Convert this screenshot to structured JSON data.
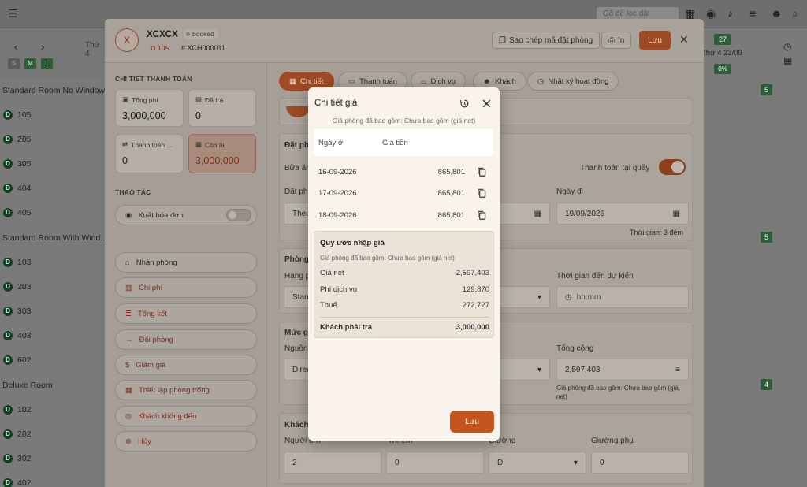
{
  "app": {
    "search_placeholder": "Gõ để lọc dặt",
    "date_prev": "Thứ 4",
    "date_right": "Thứ 4 23/09",
    "badge_27": "27",
    "badge_pct": "0%",
    "size_s": "S",
    "size_m": "M",
    "size_l": "L"
  },
  "room_groups": [
    {
      "name": "Standard Room No Window",
      "rooms": [
        "105",
        "205",
        "305",
        "404",
        "405"
      ]
    },
    {
      "name": "Standard Room With Wind...",
      "rooms": [
        "103",
        "203",
        "303",
        "403",
        "602"
      ]
    },
    {
      "name": "Deluxe Room",
      "rooms": [
        "102",
        "202",
        "302",
        "402"
      ]
    }
  ],
  "room_status_letter": "D",
  "right_badges": [
    "5",
    "5",
    "4"
  ],
  "booking": {
    "avatar": "X",
    "guest_name": "XCXCX",
    "status": "booked",
    "room_no": "105",
    "code": "# XCH000011",
    "copy_code_label": "Sao chép mã đặt phòng",
    "print_label": "In",
    "save_label": "Lưu"
  },
  "payment": {
    "section_title": "CHI TIẾT THANH TOÁN",
    "total_label": "Tổng phí",
    "total_value": "3,000,000",
    "paid_label": "Đã trả",
    "paid_value": "0",
    "payment_label": "Thanh toán ...",
    "payment_value": "0",
    "remaining_label": "Còn lại",
    "remaining_value": "3,000,000"
  },
  "actions": {
    "section_title": "THAO TÁC",
    "items": [
      {
        "label": "Xuất hóa đơn",
        "icon": "user-circle-icon"
      },
      {
        "label": "Nhận phòng",
        "icon": "bed-icon"
      },
      {
        "label": "Chi phí",
        "icon": "receipt-icon"
      },
      {
        "label": "Tổng kết",
        "icon": "list-icon"
      },
      {
        "label": "Đổi phòng",
        "icon": "arrow-right-icon"
      },
      {
        "label": "Giảm giá",
        "icon": "dollar-icon"
      },
      {
        "label": "Thiết lập phòng trống",
        "icon": "calendar-icon"
      },
      {
        "label": "Khách không đến",
        "icon": "no-show-icon"
      },
      {
        "label": "Hủy",
        "icon": "cancel-icon"
      }
    ]
  },
  "tabs": [
    {
      "label": "Chi tiết"
    },
    {
      "label": "Thanh toán"
    },
    {
      "label": "Dịch vụ"
    },
    {
      "label": "Khách"
    },
    {
      "label": "Nhật ký hoạt động"
    }
  ],
  "form": {
    "booking_section": "Đặt phò",
    "breakfast_label": "Bữa ăn",
    "pay_at_counter_label": "Thanh toán tại quầy",
    "arrival_label": "Đặt ph",
    "arrival_value": "Theo",
    "departure_label": "Ngày đi",
    "departure_value": "19/09/2026",
    "duration_note": "Thời gian: 3 đêm",
    "room_section": "Phòng",
    "room_type_label": "Hạng p",
    "room_type_value": "Stand",
    "eta_label": "Thời gian đến dự kiến",
    "eta_placeholder": "hh:mm",
    "price_section": "Mức gi",
    "source_label": "Nguồn",
    "source_value": "Direc",
    "total_label": "Tổng cộng",
    "total_value": "2,597,403",
    "total_note": "Giá phòng đã bao gồm: Chưa bao gồm (giá net)",
    "guest_section": "Khách",
    "adults_label": "Người lớn",
    "adults_value": "2",
    "children_label": "Trẻ em",
    "children_value": "0",
    "bed_label": "Giường",
    "bed_value": "D",
    "extra_bed_label": "Giường phụ",
    "extra_bed_value": "0"
  },
  "price_modal": {
    "title": "Chi tiết giá",
    "subtitle": "Giá phòng đã bao gồm: Chưa bao gồm (giá net)",
    "col_date": "Ngày ở",
    "col_price": "Giá tiền",
    "rows": [
      {
        "date": "16-09-2026",
        "price": "865,801"
      },
      {
        "date": "17-09-2026",
        "price": "865,801"
      },
      {
        "date": "18-09-2026",
        "price": "865,801"
      }
    ],
    "convention_title": "Quy ước nhập giá",
    "convention_sub": "Giá phòng đã bao gồm: Chưa bao gồm (giá net)",
    "net_label": "Giá net",
    "net_value": "2,597,403",
    "service_label": "Phí dịch vụ",
    "service_value": "129,870",
    "tax_label": "Thuế",
    "tax_value": "272,727",
    "due_label": "Khách phải trả",
    "due_value": "3,000,000",
    "save_label": "Lưu"
  }
}
